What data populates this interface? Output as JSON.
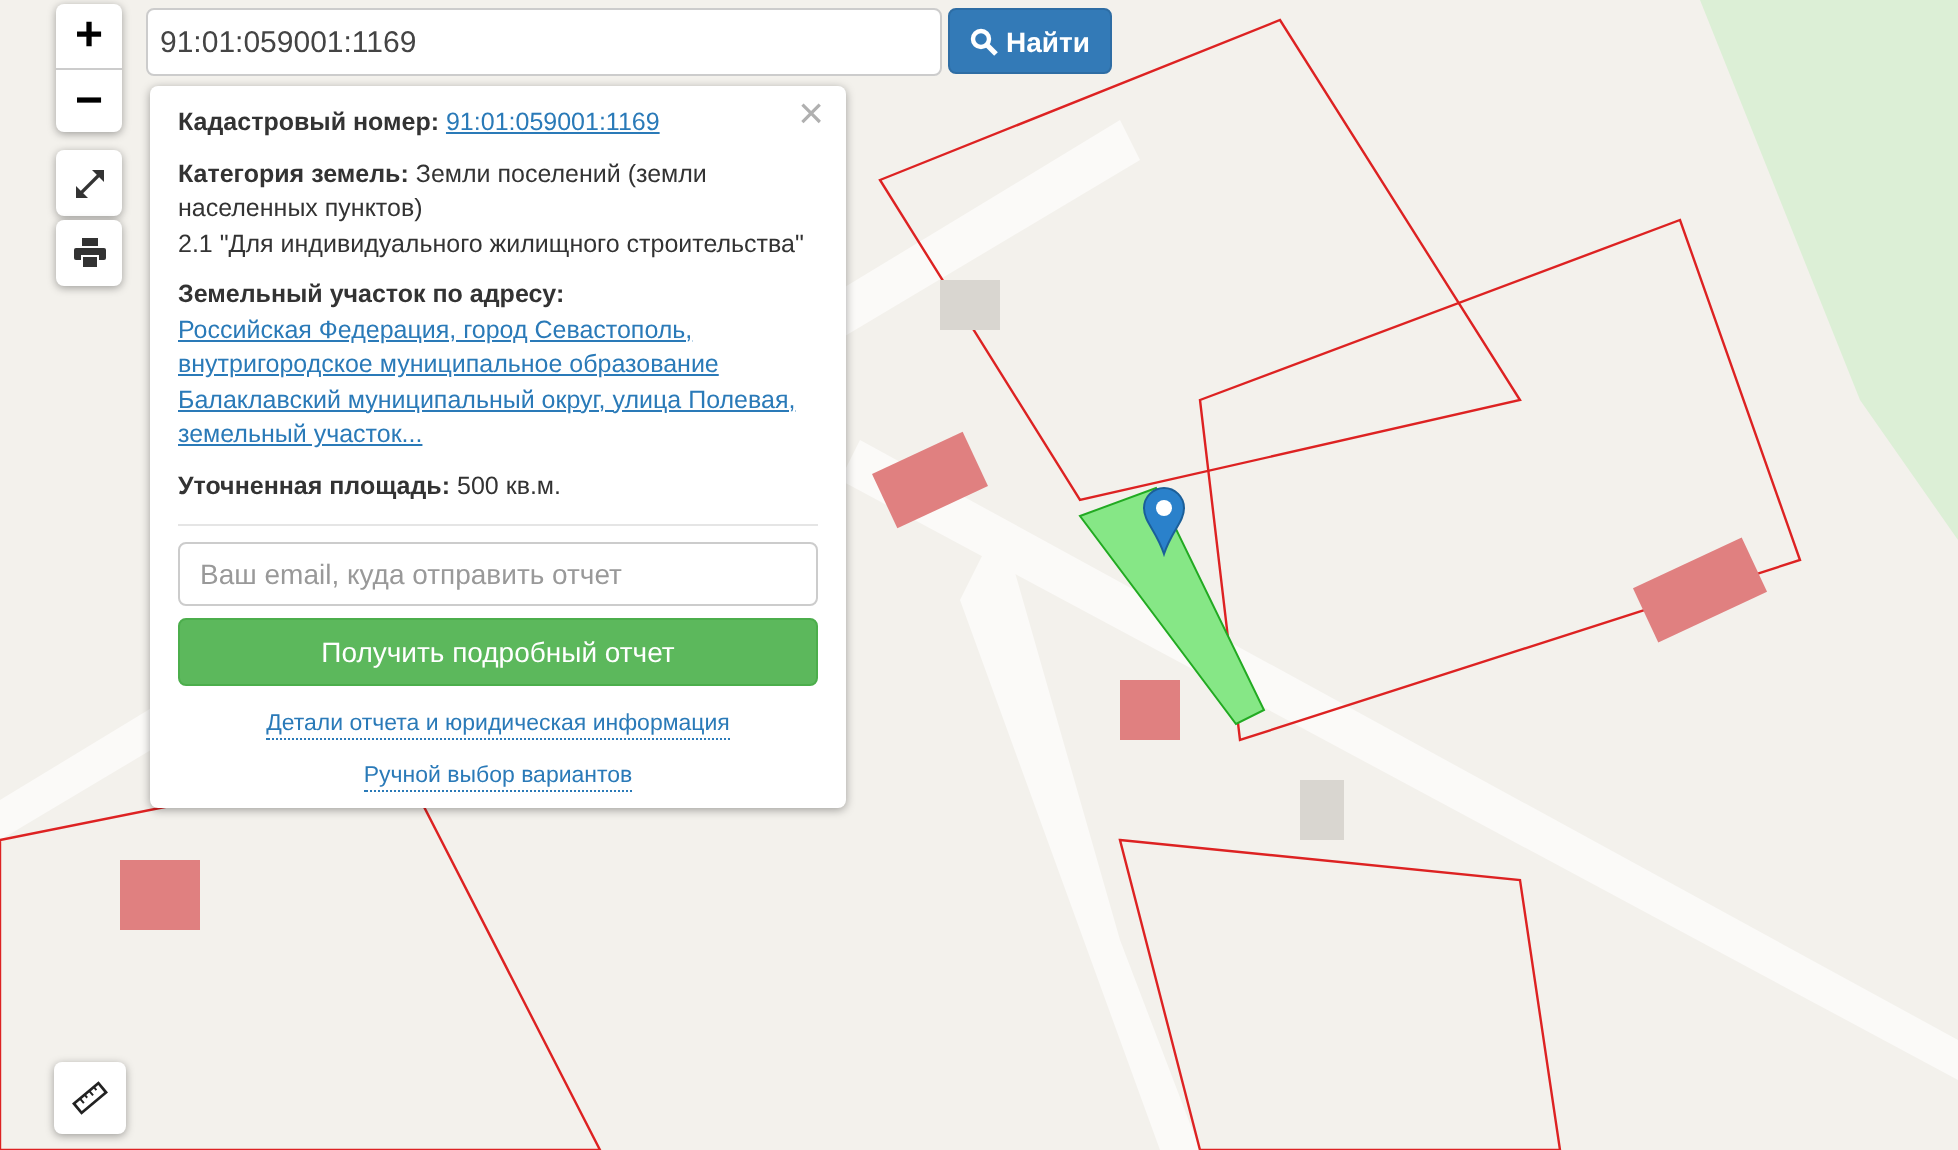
{
  "zoom": {
    "in": "+",
    "out": "−"
  },
  "search": {
    "value": "91:01:059001:1169",
    "button": "Найти"
  },
  "popup": {
    "close": "×",
    "fields": [
      {
        "kind": "link",
        "label": "Кадастровый номер:",
        "value": "91:01:059001:1169"
      },
      {
        "kind": "text",
        "label": "Категория земель:",
        "value": "Земли поселений (земли населенных пунктов)",
        "detail": "2.1 \"Для индивидуального жилищного строительства\""
      },
      {
        "kind": "link",
        "label": "Земельный участок по адресу:",
        "value": "Российская Федерация, город Севастополь, внутригородское муниципальное образование Балаклавский муниципальный округ, улица Полевая, земельный участок..."
      },
      {
        "kind": "text",
        "label": "Уточненная площадь:",
        "value": "500 кв.м."
      }
    ],
    "email": {
      "placeholder": "Ваш email, куда отправить отчет"
    },
    "submit": "Получить подробный отчет",
    "links": [
      "Детали отчета и юридическая информация",
      "Ручной выбор вариантов"
    ]
  }
}
